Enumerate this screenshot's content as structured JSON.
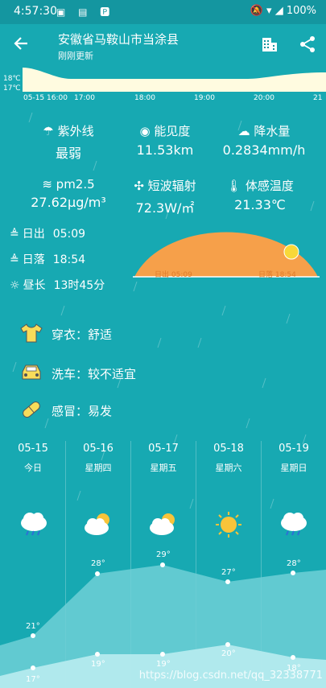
{
  "status_bar": {
    "time": "4:57:30",
    "battery": "100%"
  },
  "header": {
    "title": "安徽省马鞍山市当涂县",
    "subtitle": "刚刚更新"
  },
  "hourly": {
    "temp_high": "18℃",
    "temp_low": "17℃",
    "times": [
      "05-15 16:00",
      "17:00",
      "18:00",
      "19:00",
      "20:00",
      "21"
    ]
  },
  "metrics": [
    {
      "label": "紫外线",
      "value": "最弱",
      "icon": "umbrella-icon"
    },
    {
      "label": "能见度",
      "value": "11.53km",
      "icon": "eye-icon"
    },
    {
      "label": "降水量",
      "value": "0.2834mm/h",
      "icon": "rain-cloud-icon"
    },
    {
      "label": "pm2.5",
      "value": "27.62μg/m³",
      "icon": "haze-icon"
    },
    {
      "label": "短波辐射",
      "value": "72.3W/㎡",
      "icon": "radiation-icon"
    },
    {
      "label": "体感温度",
      "value": "21.33℃",
      "icon": "thermometer-icon"
    }
  ],
  "sun": {
    "sunrise_label": "日出",
    "sunrise": "05:09",
    "sunset_label": "日落",
    "sunset": "18:54",
    "daylength_label": "昼长",
    "daylength": "13时45分",
    "arc_sunrise": "日出 05:09",
    "arc_sunset": "日落 18:54"
  },
  "life": [
    {
      "label": "穿衣：",
      "value": "舒适",
      "icon": "shirt-icon"
    },
    {
      "label": "洗车：",
      "value": "较不适宜",
      "icon": "car-icon"
    },
    {
      "label": "感冒：",
      "value": "易发",
      "icon": "pill-icon"
    }
  ],
  "forecast": [
    {
      "date": "05-15",
      "week": "今日",
      "icon": "rain-cloud-icon",
      "high": "21°",
      "low": "17°"
    },
    {
      "date": "05-16",
      "week": "星期四",
      "icon": "partly-cloudy-icon",
      "high": "28°",
      "low": "19°"
    },
    {
      "date": "05-17",
      "week": "星期五",
      "icon": "partly-cloudy-icon",
      "high": "29°",
      "low": "19°"
    },
    {
      "date": "05-18",
      "week": "星期六",
      "icon": "sun-icon",
      "high": "27°",
      "low": "20°"
    },
    {
      "date": "05-19",
      "week": "星期日",
      "icon": "rain-cloud-icon",
      "high": "28°",
      "low": "18°"
    }
  ],
  "watermark": "https://blog.csdn.net/qq_32338771",
  "colors": {
    "background": "#17a9b2",
    "sun_arc": "#f6a04a",
    "sun_dot": "#f8d838",
    "icon_yellow": "#f8dc5a"
  }
}
